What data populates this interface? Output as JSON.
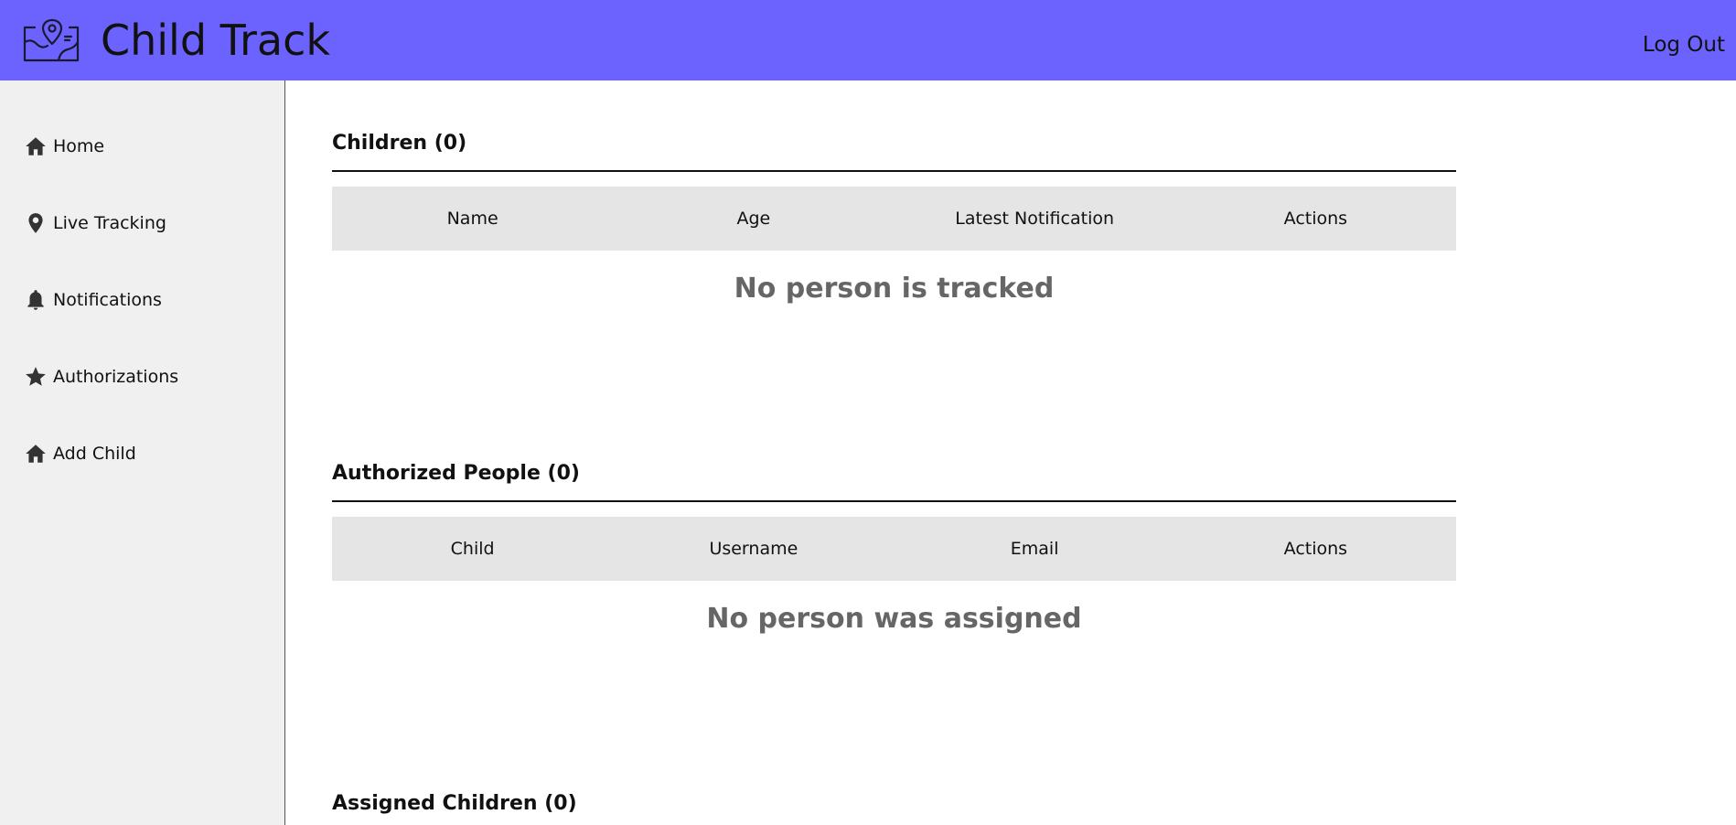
{
  "header": {
    "app_title": "Child Track",
    "logout_label": "Log Out",
    "logo_icon": "map-pin-icon",
    "background_color": "#6c63ff"
  },
  "sidebar": {
    "items": [
      {
        "label": "Home",
        "icon": "home-icon"
      },
      {
        "label": "Live Tracking",
        "icon": "location-pin-icon"
      },
      {
        "label": "Notifications",
        "icon": "bell-icon"
      },
      {
        "label": "Authorizations",
        "icon": "star-icon"
      },
      {
        "label": "Add Child",
        "icon": "home-icon"
      }
    ]
  },
  "main": {
    "children": {
      "title": "Children (0)",
      "columns": [
        "Name",
        "Age",
        "Latest Notification",
        "Actions"
      ],
      "empty_message": "No person is tracked"
    },
    "authorized_people": {
      "title": "Authorized People (0)",
      "columns": [
        "Child",
        "Username",
        "Email",
        "Actions"
      ],
      "empty_message": "No person was assigned"
    },
    "assigned_children": {
      "title": "Assigned Children (0)"
    }
  }
}
